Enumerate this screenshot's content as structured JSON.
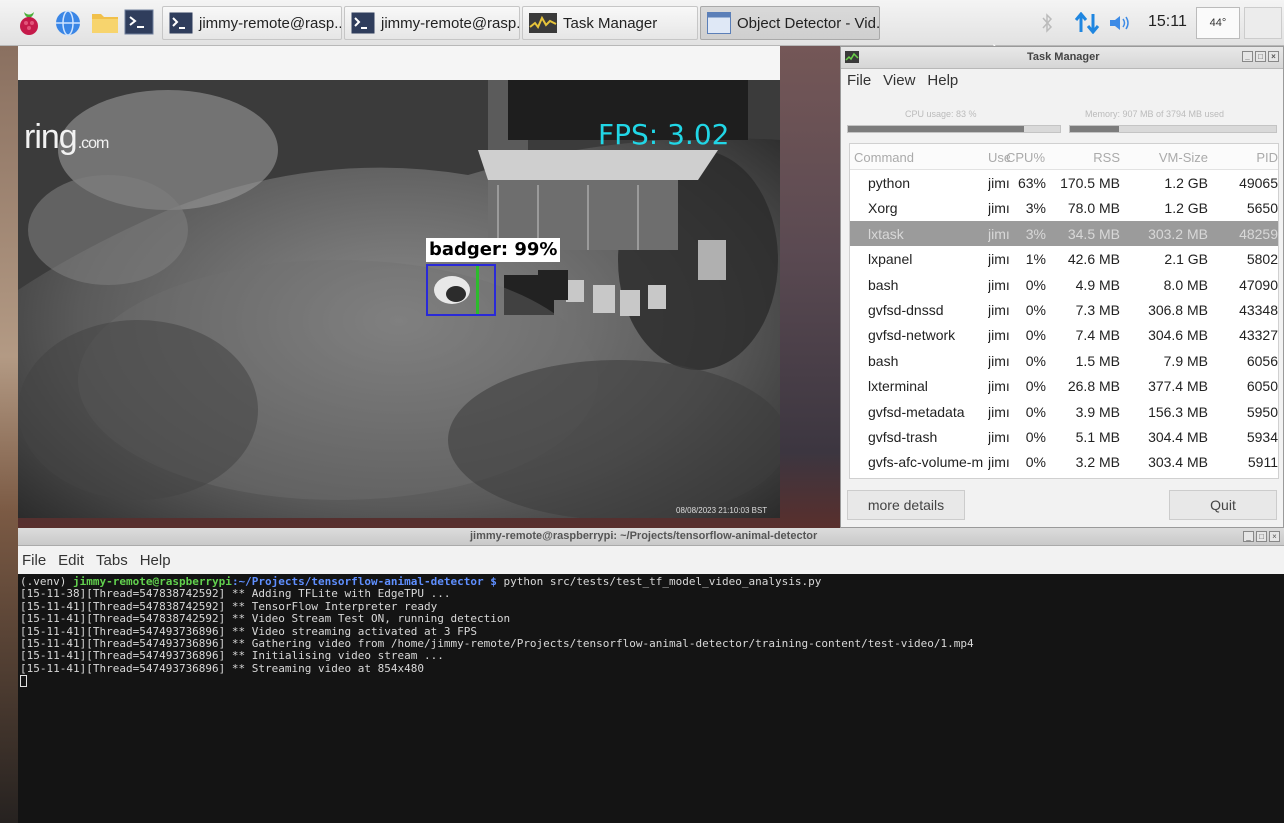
{
  "panel": {
    "tasks": [
      {
        "label": "jimmy-remote@rasp..."
      },
      {
        "label": "jimmy-remote@rasp..."
      },
      {
        "label": "Task Manager"
      },
      {
        "label": "Object Detector - Vid..."
      }
    ],
    "clock": "15:11",
    "cpu_temp": "44°"
  },
  "video": {
    "logo_main": "ring",
    "logo_suffix": ".com",
    "fps_label": "FPS: 3.02",
    "detection_label": "badger: 99%",
    "timestamp": "08/08/2023 21:10:03 BST"
  },
  "task_manager": {
    "title": "Task Manager",
    "menu": [
      "File",
      "View",
      "Help"
    ],
    "cpu_usage_label": "CPU usage: 83 %",
    "cpu_usage_fraction": 0.83,
    "memory_label": "Memory: 907 MB of 3794 MB used",
    "memory_fraction": 0.24,
    "columns": {
      "command": "Command",
      "user": "Use",
      "cpu": "CPU% ▼",
      "rss": "RSS",
      "vm": "VM-Size",
      "pid": "PID"
    },
    "rows": [
      {
        "command": "python",
        "user": "jimı",
        "cpu": "63%",
        "rss": "170.5 MB",
        "vm": "1.2 GB",
        "pid": "49065"
      },
      {
        "command": "Xorg",
        "user": "jimı",
        "cpu": "3%",
        "rss": "78.0 MB",
        "vm": "1.2 GB",
        "pid": "5650"
      },
      {
        "command": "lxtask",
        "user": "jimı",
        "cpu": "3%",
        "rss": "34.5 MB",
        "vm": "303.2 MB",
        "pid": "48259"
      },
      {
        "command": "lxpanel",
        "user": "jimı",
        "cpu": "1%",
        "rss": "42.6 MB",
        "vm": "2.1 GB",
        "pid": "5802"
      },
      {
        "command": "bash",
        "user": "jimı",
        "cpu": "0%",
        "rss": "4.9 MB",
        "vm": "8.0 MB",
        "pid": "47090"
      },
      {
        "command": "gvfsd-dnssd",
        "user": "jimı",
        "cpu": "0%",
        "rss": "7.3 MB",
        "vm": "306.8 MB",
        "pid": "43348"
      },
      {
        "command": "gvfsd-network",
        "user": "jimı",
        "cpu": "0%",
        "rss": "7.4 MB",
        "vm": "304.6 MB",
        "pid": "43327"
      },
      {
        "command": "bash",
        "user": "jimı",
        "cpu": "0%",
        "rss": "1.5 MB",
        "vm": "7.9 MB",
        "pid": "6056"
      },
      {
        "command": "lxterminal",
        "user": "jimı",
        "cpu": "0%",
        "rss": "26.8 MB",
        "vm": "377.4 MB",
        "pid": "6050"
      },
      {
        "command": "gvfsd-metadata",
        "user": "jimı",
        "cpu": "0%",
        "rss": "3.9 MB",
        "vm": "156.3 MB",
        "pid": "5950"
      },
      {
        "command": "gvfsd-trash",
        "user": "jimı",
        "cpu": "0%",
        "rss": "5.1 MB",
        "vm": "304.4 MB",
        "pid": "5934"
      },
      {
        "command": "gvfs-afc-volume-m",
        "user": "jimı",
        "cpu": "0%",
        "rss": "3.2 MB",
        "vm": "303.4 MB",
        "pid": "5911"
      }
    ],
    "selected_row": 2,
    "more_details_label": "more details",
    "quit_label": "Quit"
  },
  "terminal": {
    "title": "jimmy-remote@raspberrypi: ~/Projects/tensorflow-animal-detector",
    "menu": [
      "File",
      "Edit",
      "Tabs",
      "Help"
    ],
    "prompt_env": "(.venv) ",
    "prompt_user": "jimmy-remote@raspberrypi",
    "prompt_path": ":~/Projects/tensorflow-animal-detector $",
    "command": " python src/tests/test_tf_model_video_analysis.py",
    "log_lines": [
      "[15-11-38][Thread=547838742592] ** Adding TFLite with EdgeTPU ...",
      "[15-11-41][Thread=547838742592] ** TensorFlow Interpreter ready",
      "[15-11-41][Thread=547838742592] ** Video Stream Test ON, running detection",
      "[15-11-41][Thread=547493736896] ** Video streaming activated at 3 FPS",
      "[15-11-41][Thread=547493736896] ** Gathering video from /home/jimmy-remote/Projects/tensorflow-animal-detector/training-content/test-video/1.mp4",
      "[15-11-41][Thread=547493736896] ** Initialising video stream ...",
      "[15-11-41][Thread=547493736896] ** Streaming video at 854x480"
    ]
  }
}
